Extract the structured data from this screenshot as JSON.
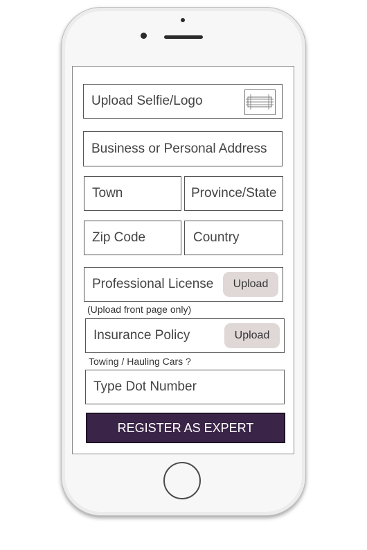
{
  "form": {
    "upload_selfie_label": "Upload Selfie/Logo",
    "upload_icon": "image-placeholder-icon",
    "address_label": "Business or Personal Address",
    "town_label": "Town",
    "province_label": "Province/State",
    "zip_label": "Zip Code",
    "country_label": "Country",
    "license_label": "Professional License",
    "license_upload": "Upload",
    "license_note": "(Upload front page only)",
    "insurance_label": "Insurance Policy",
    "insurance_upload": "Upload",
    "towing_note": "Towing / Hauling Cars ?",
    "dot_number_placeholder": "Type Dot Number",
    "register_button": "REGISTER AS EXPERT"
  },
  "colors": {
    "register_bg": "#3a2447",
    "upload_button_bg": "#e0d7d7"
  }
}
